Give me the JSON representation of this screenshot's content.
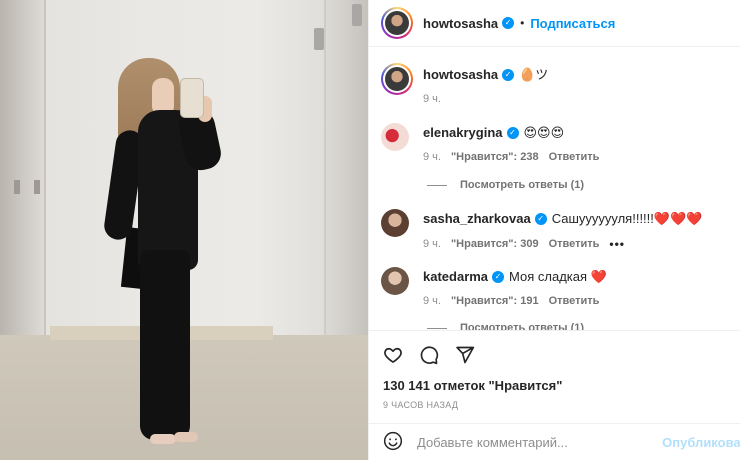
{
  "header": {
    "username": "howtosasha",
    "separator": "•",
    "follow_label": "Подписаться"
  },
  "caption": {
    "username": "howtosasha",
    "text": "🥚ツ",
    "time": "9 ч."
  },
  "comments": [
    {
      "username": "elenakrygina",
      "text": "😍😍😍",
      "time": "9 ч.",
      "likes": "\"Нравится\": 238",
      "reply_label": "Ответить",
      "view_replies": "Посмотреть ответы (1)",
      "more": ""
    },
    {
      "username": "sasha_zharkovaa",
      "text": "Сашууууууля!!!!!!❤️❤️❤️",
      "time": "9 ч.",
      "likes": "\"Нравится\": 309",
      "reply_label": "Ответить",
      "view_replies": "",
      "more": "•••"
    },
    {
      "username": "katedarma",
      "text": "Моя сладкая ❤️",
      "time": "9 ч.",
      "likes": "\"Нравится\": 191",
      "reply_label": "Ответить",
      "view_replies": "Посмотреть ответы (1)",
      "more": ""
    }
  ],
  "actions": {
    "like_icon": "heart-icon",
    "comment_icon": "comment-icon",
    "share_icon": "send-icon"
  },
  "likes_count": "130 141 отметок \"Нравится\"",
  "posted_ago": "9 часов назад",
  "add_comment": {
    "emoji_icon": "smiley-icon",
    "placeholder": "Добавьте комментарий...",
    "publish_label": "Опубликовать"
  },
  "colors": {
    "accent": "#0095f6",
    "text": "#262626",
    "muted": "#8e8e8e",
    "publish_disabled": "#b2dffc",
    "heart_red": "#ed4956"
  }
}
